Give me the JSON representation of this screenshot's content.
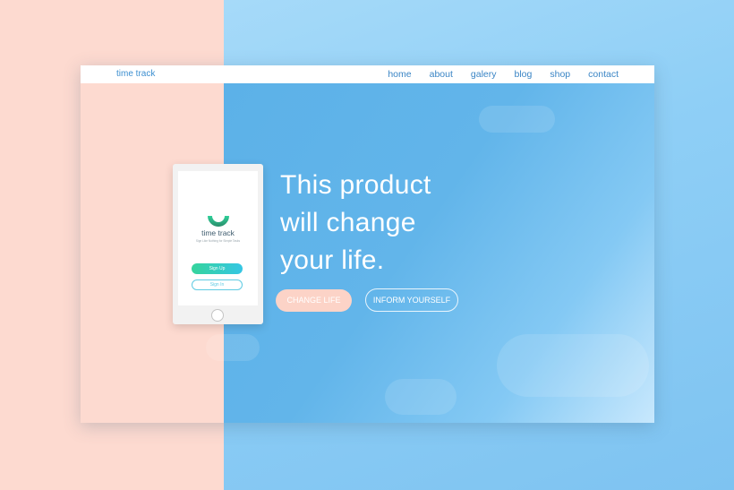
{
  "brand": {
    "name": "time track"
  },
  "nav": {
    "items": [
      "home",
      "about",
      "galery",
      "blog",
      "shop",
      "contact"
    ]
  },
  "hero": {
    "headline_lines": [
      "This product",
      "will change",
      "your life."
    ],
    "primary_cta": "CHANGE LIFE",
    "secondary_cta": "INFORM YOURSELF"
  },
  "phone_app": {
    "title": "time track",
    "tagline": "Sign Like Nothing for Simple Tasks",
    "signup_label": "Sign Up",
    "signin_label": "Sign In",
    "logo_icon": "half-moon-logo-icon"
  },
  "colors": {
    "peach": "#fddad0",
    "sky": "#62b5ea",
    "nav_text": "#3a85c5",
    "green_gradient_start": "#35d49c",
    "teal_gradient_end": "#35c6e4"
  }
}
